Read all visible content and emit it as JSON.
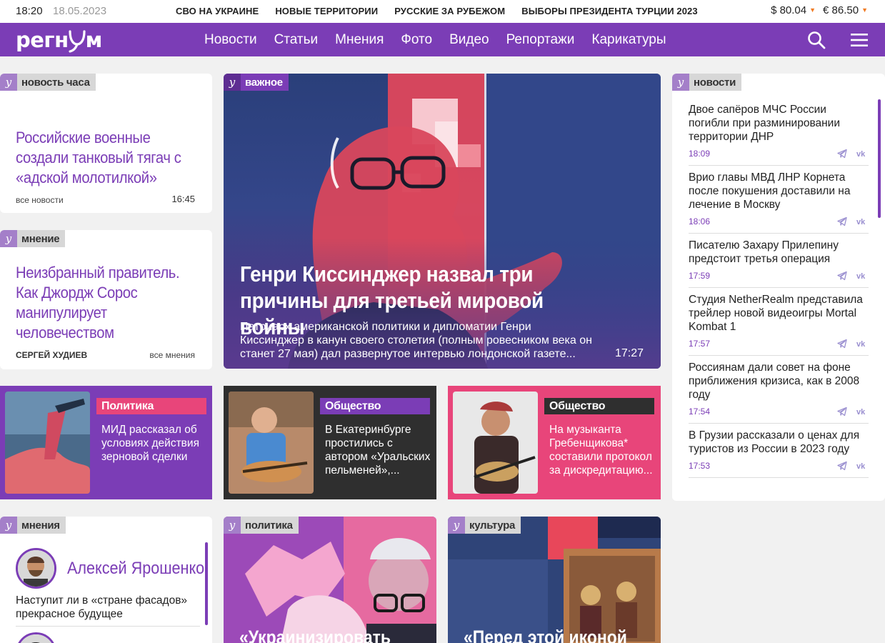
{
  "topbar": {
    "time": "18:20",
    "date": "18.05.2023",
    "tags": [
      "СВО НА УКРАИНЕ",
      "НОВЫЕ ТЕРРИТОРИИ",
      "РУССКИЕ ЗА РУБЕЖОМ",
      "ВЫБОРЫ ПРЕЗИДЕНТА ТУРЦИИ 2023"
    ],
    "usd": "$ 80.04",
    "eur": "€ 86.50"
  },
  "nav": {
    "logo_left": "регн",
    "logo_right": "м",
    "menu": [
      "Новости",
      "Статьи",
      "Мнения",
      "Фото",
      "Видео",
      "Репортажи",
      "Карикатуры"
    ]
  },
  "hour": {
    "label": "новость часа",
    "title": "Российские военные создали танковый тягач с «адской молотилкой»",
    "footer_link": "все новости",
    "time": "16:45"
  },
  "opinion": {
    "label": "мнение",
    "title": "Неизбранный правитель. Как Джордж Сорос манипулирует человечеством",
    "author": "СЕРГЕЙ ХУДИЕВ",
    "footer_link": "все мнения"
  },
  "main": {
    "label": "важное",
    "title": "Генри Киссинджер назвал три причины для третьей мировой войны",
    "lead": "Патриарх американской политики и дипломатии Генри Киссинджер в канун своего столетия (полным ровесником века он станет 27 мая) дал развернутое интервью лондонской газете...",
    "time": "17:27"
  },
  "news": {
    "label": "новости",
    "items": [
      {
        "title": "Двое сапёров МЧС России погибли при разминировании территории ДНР",
        "time": "18:09"
      },
      {
        "title": "Врио главы МВД ЛНР Корнета после покушения доставили на лечение в Москву",
        "time": "18:06"
      },
      {
        "title": "Писателю Захару Прилепину предстоит третья операция",
        "time": "17:59"
      },
      {
        "title": "Студия NetherRealm представила трейлер новой видеоигры Mortal Kombat 1",
        "time": "17:57"
      },
      {
        "title": "Россиянам дали совет на фоне приближения кризиса, как в 2008 году",
        "time": "17:54"
      },
      {
        "title": "В Грузии рассказали о ценах для туристов из России в 2023 году",
        "time": "17:53"
      }
    ]
  },
  "row": [
    {
      "category": "Политика",
      "text": "МИД рассказал об условиях действия зерновой сделки",
      "bg": "#7b3db6",
      "cat_bg": "#e8457a"
    },
    {
      "category": "Общество",
      "text": "В Екатеринбурге простились с автором «Уральских пельменей»,...",
      "bg": "#2f2f2f",
      "cat_bg": "#7b3db6"
    },
    {
      "category": "Общество",
      "text": "На музыканта Гребенщикова* составили протокол за дискредитацию...",
      "bg": "#e8457a",
      "cat_bg": "#2f2f2f"
    }
  ],
  "opinions": {
    "label": "мнения",
    "name": "Алексей Ярошенко",
    "text": "Наступит ли в «стране фасадов» прекрасное будущее"
  },
  "bottom": [
    {
      "label": "политика",
      "title": "«Украинизировать"
    },
    {
      "label": "культура",
      "title": "«Перед этой иконой"
    }
  ],
  "icons": [
    "search-icon",
    "menu-icon",
    "telegram-icon",
    "vk-icon",
    "regnum-y-icon"
  ],
  "colors": {
    "brand": "#7b3db6",
    "accent": "#e8457a",
    "dark": "#2f2f2f"
  }
}
